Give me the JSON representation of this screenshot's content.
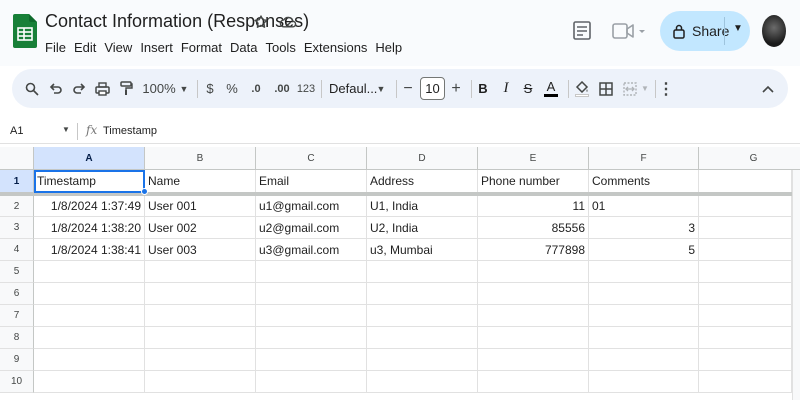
{
  "app": {
    "doc_title": "Contact Information (Responses)",
    "brand_color": "#188038",
    "accent_color": "#1a73e8"
  },
  "menu": [
    "File",
    "Edit",
    "View",
    "Insert",
    "Format",
    "Data",
    "Tools",
    "Extensions",
    "Help"
  ],
  "header_actions": {
    "share_label": "Share"
  },
  "toolbar": {
    "zoom": "100%",
    "currency": "$",
    "percent": "%",
    "decrease_decimal": ".0",
    "increase_decimal": ".00",
    "number_format": "123",
    "font": "Defaul...",
    "font_size": "10",
    "minus": "−",
    "plus": "+",
    "bold": "B",
    "italic": "I",
    "strike": "S",
    "text_color": "A"
  },
  "formula_bar": {
    "cell_ref": "A1",
    "fx": "fx",
    "content": "Timestamp"
  },
  "columns": [
    "A",
    "B",
    "C",
    "D",
    "E",
    "F",
    "G"
  ],
  "rows": [
    "1",
    "2",
    "3",
    "4",
    "5",
    "6",
    "7",
    "8",
    "9",
    "10"
  ],
  "table": {
    "headers": [
      "Timestamp",
      "Name",
      "Email",
      "Address",
      "Phone number",
      "Comments"
    ],
    "records": [
      [
        "1/8/2024 1:37:49",
        "User 001",
        "u1@gmail.com",
        "U1, India",
        "11",
        "01"
      ],
      [
        "1/8/2024 1:38:20",
        "User 002",
        "u2@gmail.com",
        "U2, India",
        "85556",
        "3"
      ],
      [
        "1/8/2024 1:38:41",
        "User 003",
        "u3@gmail.com",
        "u3, Mumbai",
        "777898",
        "5"
      ]
    ]
  }
}
